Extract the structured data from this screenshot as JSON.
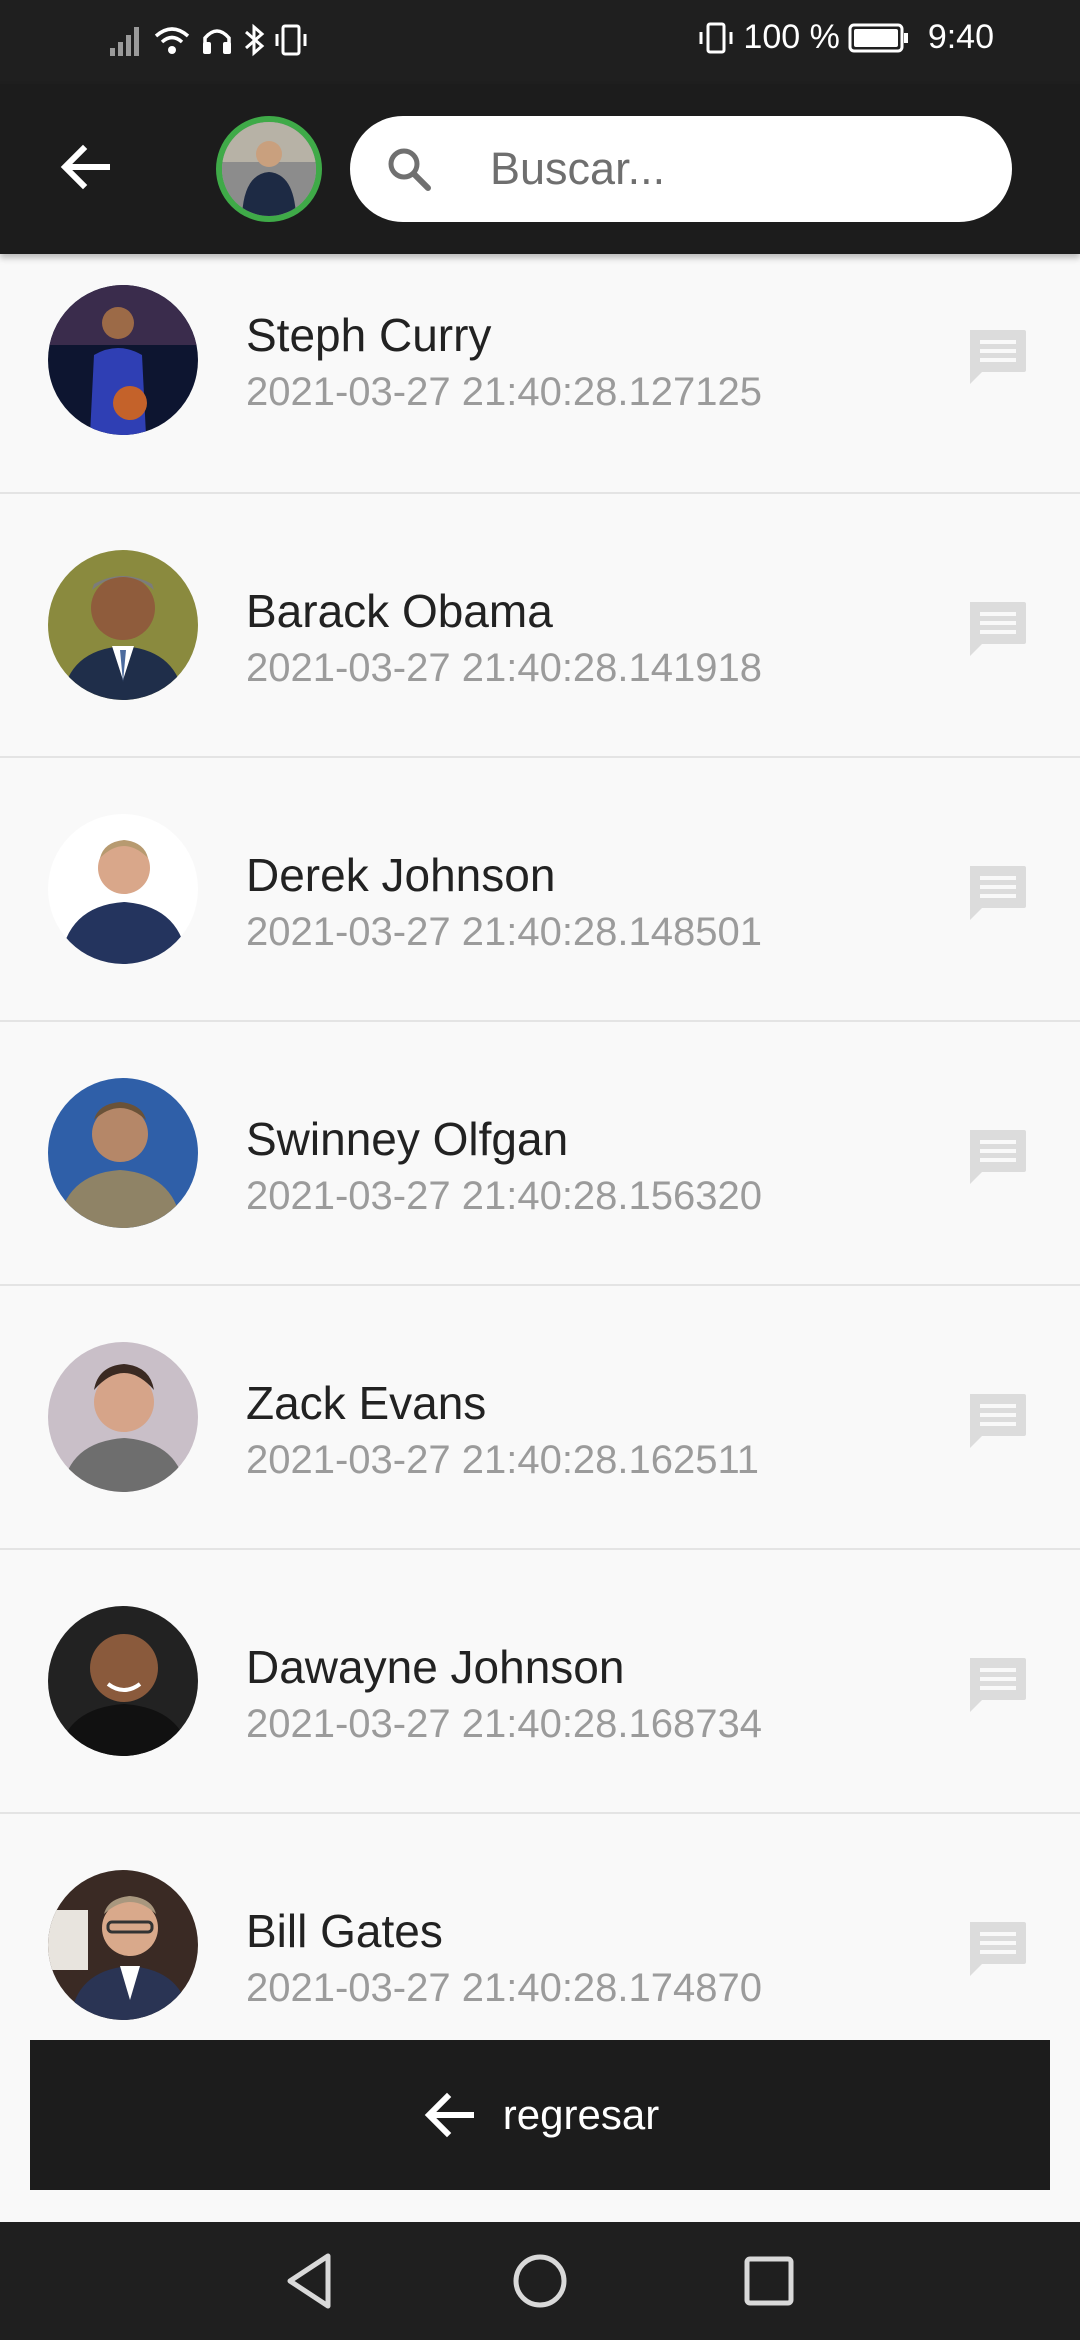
{
  "status_bar": {
    "battery": "100 %",
    "time": "9:40"
  },
  "app_bar": {
    "back_icon": "arrow-left-icon",
    "search": {
      "placeholder": "Buscar...",
      "value": "",
      "icon": "search-icon"
    }
  },
  "contacts": [
    {
      "name": "Steph Curry",
      "date": "2021-03-27 21:40:28.127125",
      "icon": "message-icon"
    },
    {
      "name": "Barack Obama",
      "date": "2021-03-27 21:40:28.141918",
      "icon": "message-icon"
    },
    {
      "name": "Derek Johnson",
      "date": "2021-03-27 21:40:28.148501",
      "icon": "message-icon"
    },
    {
      "name": "Swinney Olfgan",
      "date": "2021-03-27 21:40:28.156320",
      "icon": "message-icon"
    },
    {
      "name": "Zack Evans",
      "date": "2021-03-27 21:40:28.162511",
      "icon": "message-icon"
    },
    {
      "name": "Dawayne Johnson",
      "date": "2021-03-27 21:40:28.168734",
      "icon": "message-icon"
    },
    {
      "name": "Bill Gates",
      "date": "2021-03-27 21:40:28.174870",
      "icon": "message-icon"
    }
  ],
  "bottom_button": {
    "label": "regresar",
    "icon": "arrow-left-icon"
  },
  "colors": {
    "app_bar": "#1c1c1c",
    "avatar_ring": "#3faa48",
    "secondary_text": "#9b9b9b",
    "message_icon": "#dcdcdc"
  }
}
